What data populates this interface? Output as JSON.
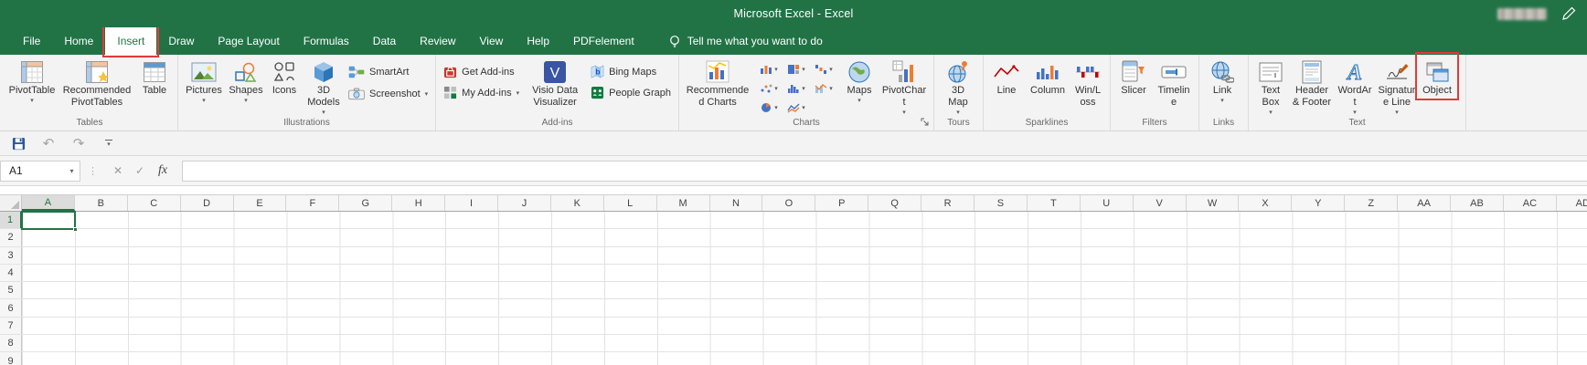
{
  "colors": {
    "excel_green": "#217346",
    "highlight_red": "#e03a3a",
    "ribbon_bg": "#f3f3f3"
  },
  "title_bar": {
    "title": "Microsoft Excel - Excel"
  },
  "tab_bar": {
    "tabs": [
      "File",
      "Home",
      "Insert",
      "Draw",
      "Page Layout",
      "Formulas",
      "Data",
      "Review",
      "View",
      "Help",
      "PDFelement"
    ],
    "selected_tab": "Insert",
    "tell_me": "Tell me what you want to do"
  },
  "ribbon": {
    "tables": {
      "label": "Tables",
      "pivottable": "PivotTable",
      "recommended_pivottables": "Recommended PivotTables",
      "table": "Table"
    },
    "illustrations": {
      "label": "Illustrations",
      "pictures": "Pictures",
      "shapes": "Shapes",
      "icons": "Icons",
      "models_3d": "3D Models",
      "smartart": "SmartArt",
      "screenshot": "Screenshot"
    },
    "addins": {
      "label": "Add-ins",
      "get_addins": "Get Add-ins",
      "my_addins": "My Add-ins",
      "visio": "Visio Data Visualizer",
      "bing_maps": "Bing Maps",
      "people_graph": "People Graph"
    },
    "charts": {
      "label": "Charts",
      "recommended_charts": "Recommended Charts",
      "maps": "Maps",
      "pivotchart": "PivotChart"
    },
    "tours": {
      "label": "Tours",
      "map_3d": "3D Map"
    },
    "sparklines": {
      "label": "Sparklines",
      "line": "Line",
      "column": "Column",
      "win_loss": "Win/Loss"
    },
    "filters": {
      "label": "Filters",
      "slicer": "Slicer",
      "timeline": "Timeline"
    },
    "links": {
      "label": "Links",
      "link": "Link"
    },
    "text": {
      "label": "Text",
      "text_box": "Text Box",
      "header_footer": "Header & Footer",
      "wordart": "WordArt",
      "signature_line": "Signature Line",
      "object": "Object"
    }
  },
  "formula_bar": {
    "name_box": "A1",
    "fx_label": "fx"
  },
  "grid": {
    "columns": [
      "A",
      "B",
      "C",
      "D",
      "E",
      "F",
      "G",
      "H",
      "I",
      "J",
      "K",
      "L",
      "M",
      "N",
      "O",
      "P",
      "Q",
      "R",
      "S",
      "T",
      "U",
      "V",
      "W",
      "X",
      "Y",
      "Z",
      "AA",
      "AB",
      "AC",
      "AD"
    ],
    "rows": [
      "1",
      "2",
      "3",
      "4",
      "5",
      "6",
      "7",
      "8",
      "9"
    ],
    "selected_cell": "A1"
  }
}
